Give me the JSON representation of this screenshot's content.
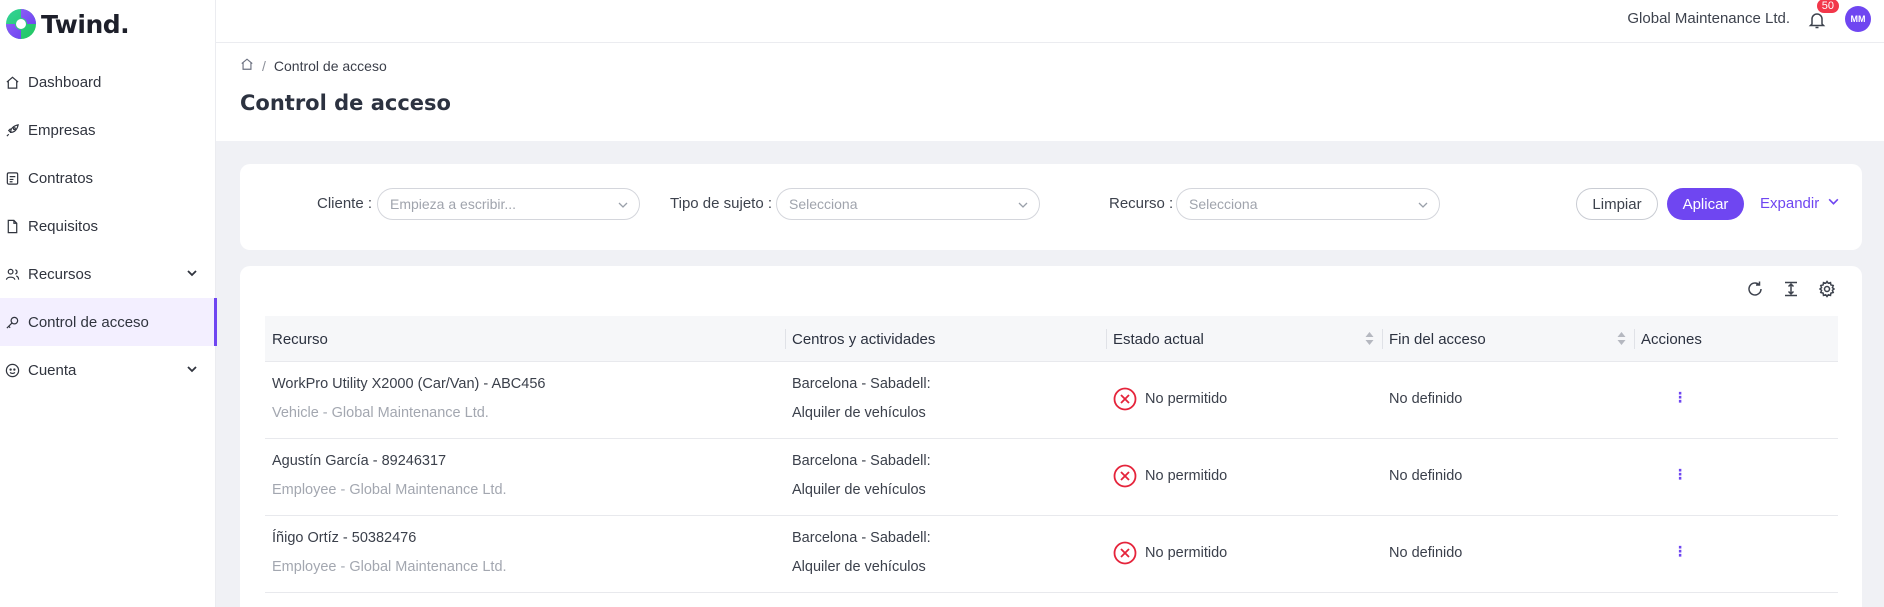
{
  "app": {
    "name": "Twind."
  },
  "sidebar": {
    "items": [
      {
        "label": "Dashboard",
        "icon": "home-icon"
      },
      {
        "label": "Empresas",
        "icon": "building-icon"
      },
      {
        "label": "Contratos",
        "icon": "contract-icon"
      },
      {
        "label": "Requisitos",
        "icon": "document-icon"
      },
      {
        "label": "Recursos",
        "icon": "users-icon",
        "expandable": true
      },
      {
        "label": "Control de acceso",
        "icon": "key-icon",
        "active": true
      },
      {
        "label": "Cuenta",
        "icon": "account-icon",
        "expandable": true
      }
    ]
  },
  "topbar": {
    "company": "Global Maintenance Ltd.",
    "notifications": "50",
    "avatar_initials": "MM"
  },
  "breadcrumb": {
    "current": "Control de acceso"
  },
  "page": {
    "title": "Control de acceso"
  },
  "filters": {
    "cliente": {
      "label": "Cliente",
      "placeholder": "Empieza a escribir..."
    },
    "tipo": {
      "label": "Tipo de sujeto",
      "placeholder": "Selecciona"
    },
    "recurso": {
      "label": "Recurso",
      "placeholder": "Selecciona"
    },
    "clear_label": "Limpiar",
    "apply_label": "Aplicar",
    "expand_label": "Expandir"
  },
  "table": {
    "columns": {
      "recurso": "Recurso",
      "centros": "Centros y actividades",
      "estado": "Estado actual",
      "fin": "Fin del acceso",
      "acciones": "Acciones"
    },
    "rows": [
      {
        "name": "WorkPro Utility X2000 (Car/Van) - ABC456",
        "sub": "Vehicle - Global Maintenance Ltd.",
        "centro": "Barcelona - Sabadell:",
        "actividad": "Alquiler de vehículos",
        "estado": "No permitido",
        "fin": "No definido"
      },
      {
        "name": "Agustín García - 89246317",
        "sub": "Employee - Global Maintenance Ltd.",
        "centro": "Barcelona - Sabadell:",
        "actividad": "Alquiler de vehículos",
        "estado": "No permitido",
        "fin": "No definido"
      },
      {
        "name": "Íñigo Ortíz - 50382476",
        "sub": "Employee - Global Maintenance Ltd.",
        "centro": "Barcelona - Sabadell:",
        "actividad": "Alquiler de vehículos",
        "estado": "No permitido",
        "fin": "No definido"
      }
    ]
  },
  "colors": {
    "accent": "#6f46f1",
    "danger": "#e5243b",
    "badge": "#f2374a"
  }
}
